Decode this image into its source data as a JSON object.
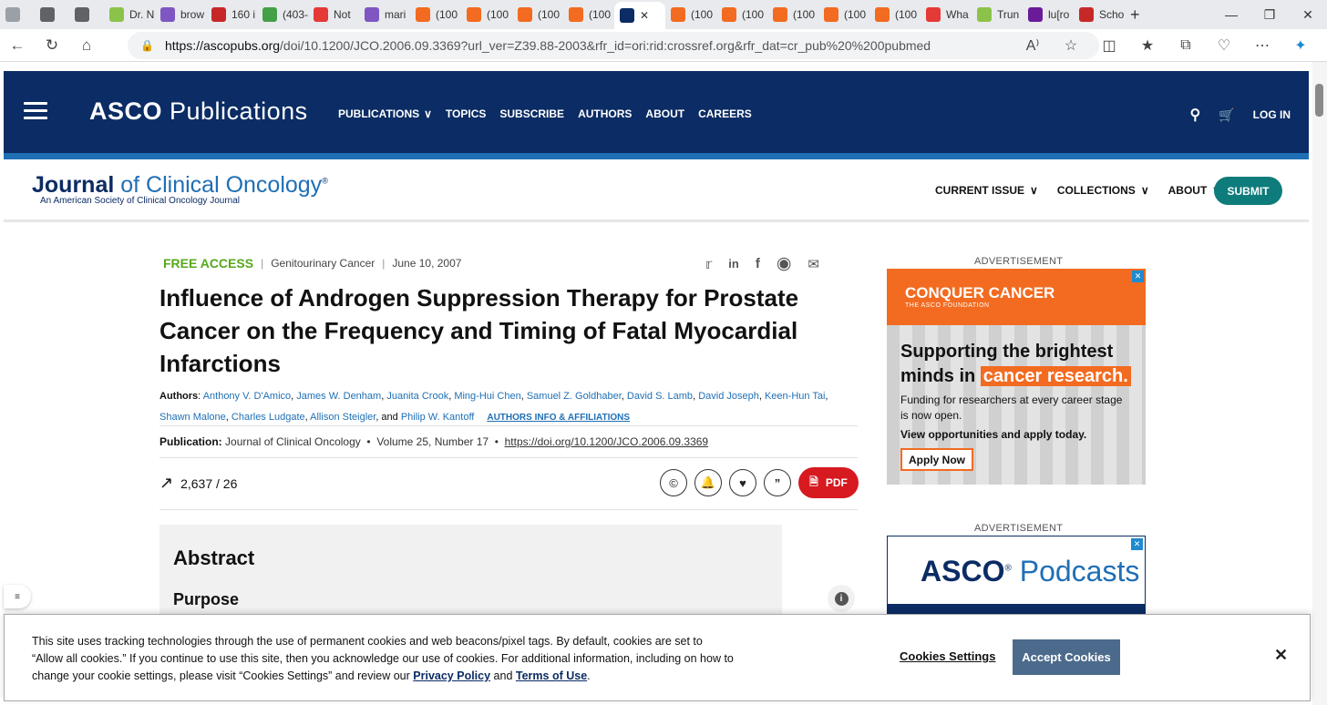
{
  "browser": {
    "tabs": [
      {
        "label": "",
        "icon": "profile-icon",
        "color": "#9aa0a6"
      },
      {
        "label": "",
        "icon": "workspaces-icon",
        "color": "#5f6368"
      },
      {
        "label": "",
        "icon": "tab-actions-icon",
        "color": "#5f6368"
      },
      {
        "label": "Dr. N",
        "icon": "play-icon",
        "color": "#8bc34a"
      },
      {
        "label": "brow",
        "icon": "yahoo-icon",
        "color": "#7e57c2"
      },
      {
        "label": "160 i",
        "icon": "bi-icon",
        "color": "#c62828"
      },
      {
        "label": "(403-",
        "icon": "g-icon",
        "color": "#43a047"
      },
      {
        "label": "Not",
        "icon": "alert-icon",
        "color": "#e53935"
      },
      {
        "label": "mari",
        "icon": "yahoo-icon",
        "color": "#7e57c2"
      },
      {
        "label": "(100",
        "icon": "bookmark-icon",
        "color": "#f26b21"
      },
      {
        "label": "(100",
        "icon": "bookmark-icon",
        "color": "#f26b21"
      },
      {
        "label": "(100",
        "icon": "bookmark-icon",
        "color": "#f26b21"
      },
      {
        "label": "(100",
        "icon": "bookmark-icon",
        "color": "#f26b21"
      },
      {
        "label": "",
        "icon": "asco-a-icon",
        "color": "#0b2c64",
        "active": true
      },
      {
        "label": "(100",
        "icon": "bookmark-icon",
        "color": "#f26b21"
      },
      {
        "label": "(100",
        "icon": "bookmark-icon",
        "color": "#f26b21"
      },
      {
        "label": "(100",
        "icon": "bookmark-icon",
        "color": "#f26b21"
      },
      {
        "label": "(100",
        "icon": "bookmark-icon",
        "color": "#f26b21"
      },
      {
        "label": "(100",
        "icon": "bookmark-icon",
        "color": "#f26b21"
      },
      {
        "label": "Wha",
        "icon": "youtube-icon",
        "color": "#e53935"
      },
      {
        "label": "Trun",
        "icon": "play-icon",
        "color": "#8bc34a"
      },
      {
        "label": "lu[ro",
        "icon": "yahoo-icon",
        "color": "#6a1b9a"
      },
      {
        "label": "Scho",
        "icon": "bi-icon",
        "color": "#c62828"
      }
    ],
    "url_host": "https://ascopubs.org",
    "url_rest": "/doi/10.1200/JCO.2006.09.3369?url_ver=Z39.88-2003&rfr_id=ori:rid:crossref.org&rfr_dat=cr_pub%20%200pubmed"
  },
  "site": {
    "logo_bold": "ASCO",
    "logo_rest": " Publications",
    "nav": [
      "PUBLICATIONS",
      "TOPICS",
      "SUBSCRIBE",
      "AUTHORS",
      "ABOUT",
      "CAREERS"
    ],
    "login": "LOG IN"
  },
  "journal": {
    "logo_j": "Journal",
    "logo_rest": " of Clinical Oncology",
    "subtitle": "An American Society of Clinical Oncology Journal",
    "nav": [
      "CURRENT ISSUE",
      "COLLECTIONS",
      "ABOUT"
    ],
    "submit": "SUBMIT"
  },
  "article": {
    "access": "FREE ACCESS",
    "section": "Genitourinary Cancer",
    "date": "June 10, 2007",
    "title": "Influence of Androgen Suppression Therapy for Prostate Cancer on the Frequency and Timing of Fatal Myocardial Infarctions",
    "authors_label": "Authors",
    "authors": [
      "Anthony V. D'Amico",
      "James W. Denham",
      "Juanita Crook",
      "Ming-Hui Chen",
      "Samuel Z. Goldhaber",
      "David S. Lamb",
      "David Joseph",
      "Keen-Hun Tai",
      "Shawn Malone",
      "Charles Ludgate",
      "Allison Steigler",
      "Philip W. Kantoff"
    ],
    "affiliations_link": "AUTHORS INFO & AFFILIATIONS",
    "publication_label": "Publication:",
    "journal_name": "Journal of Clinical Oncology",
    "volume": "Volume 25, Number 17",
    "doi": "https://doi.org/10.1200/JCO.2006.09.3369",
    "metrics": "2,637 / 26",
    "pdf": "PDF",
    "abstract_heading": "Abstract",
    "purpose_heading": "Purpose"
  },
  "ads": {
    "label": "ADVERTISEMENT",
    "ad1": {
      "brand": "CONQUER CANCER",
      "brand_sub": "THE ASCO FOUNDATION",
      "head1": "Supporting the brightest",
      "head2": "minds in ",
      "head_hl": "cancer research.",
      "text": "Funding for researchers at every career stage is now open.",
      "text2": "View opportunities and apply today.",
      "button": "Apply Now"
    },
    "ad2": {
      "bold": "ASCO",
      "rest": "Podcasts"
    }
  },
  "cookie": {
    "text": "This site uses tracking technologies through the use of permanent cookies and web beacons/pixel tags. By default, cookies are set to “Allow all cookies.” If you continue to use this site, then you acknowledge our use of cookies. For additional information, including on how to change your cookie settings, please visit “Cookies Settings” and review our ",
    "privacy": "Privacy Policy",
    "and": " and ",
    "terms": "Terms of Use",
    "end": ".",
    "settings": "Cookies Settings",
    "accept": "Accept Cookies"
  }
}
